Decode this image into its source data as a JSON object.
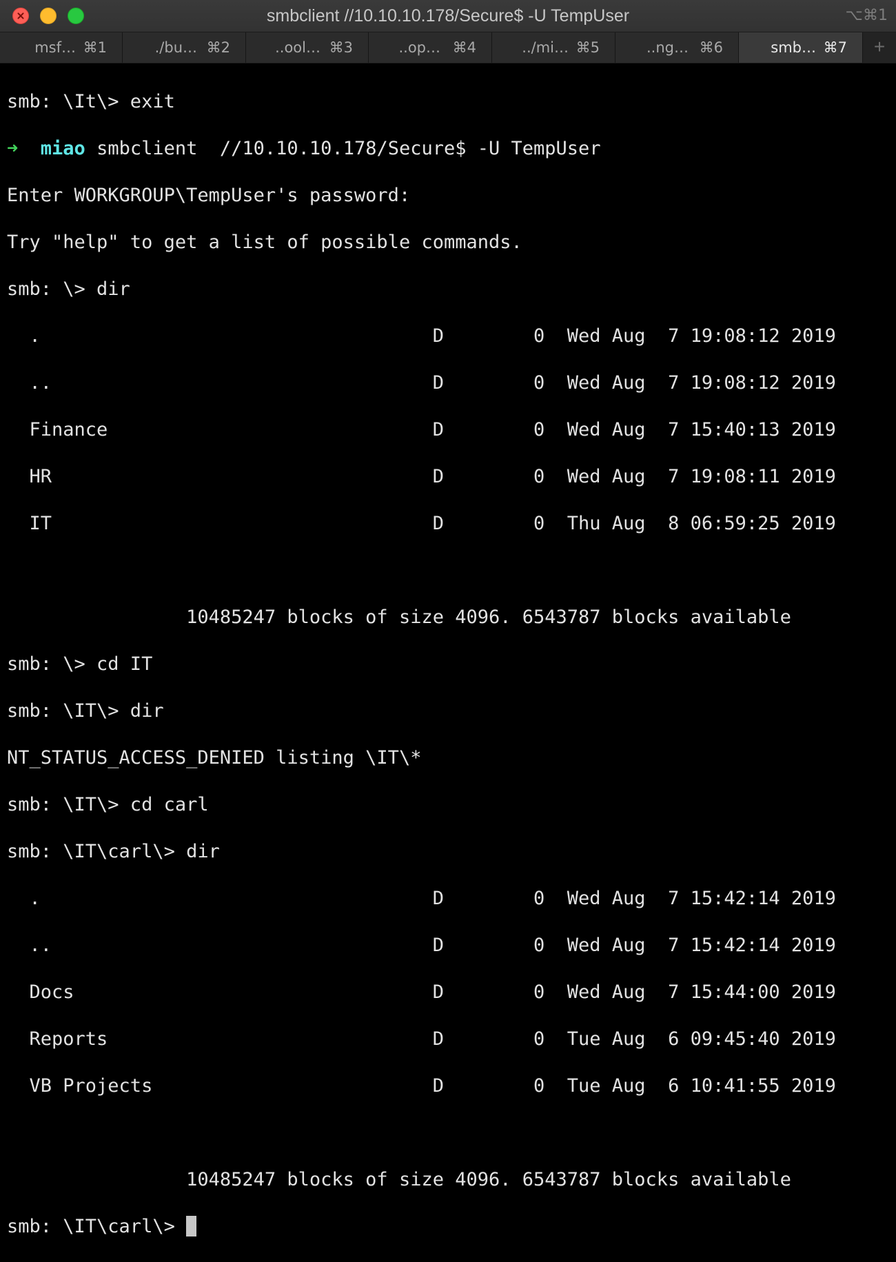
{
  "window": {
    "title": "smbclient //10.10.10.178/Secure$ -U TempUser",
    "shortcut": "⌥⌘1"
  },
  "tabs": [
    {
      "label": "msf…",
      "shortcut": "⌘1",
      "active": false
    },
    {
      "label": "./bu…",
      "shortcut": "⌘2",
      "active": false
    },
    {
      "label": "..ool…",
      "shortcut": "⌘3",
      "active": false
    },
    {
      "label": "..op…",
      "shortcut": "⌘4",
      "active": false
    },
    {
      "label": "../mi…",
      "shortcut": "⌘5",
      "active": false
    },
    {
      "label": "..ng…",
      "shortcut": "⌘6",
      "active": false
    },
    {
      "label": "smb…",
      "shortcut": "⌘7",
      "active": true
    }
  ],
  "add_tab_label": "+",
  "terminal": {
    "prompt_arrow": "➜",
    "prompt_user": "miao",
    "lines": [
      "smb: \\It\\> exit",
      "smbclient  //10.10.10.178/Secure$ -U TempUser",
      "Enter WORKGROUP\\TempUser's password:",
      "Try \"help\" to get a list of possible commands.",
      "smb: \\> dir",
      "  .                                   D        0  Wed Aug  7 19:08:12 2019",
      "  ..                                  D        0  Wed Aug  7 19:08:12 2019",
      "  Finance                             D        0  Wed Aug  7 15:40:13 2019",
      "  HR                                  D        0  Wed Aug  7 19:08:11 2019",
      "  IT                                  D        0  Thu Aug  8 06:59:25 2019",
      "",
      "                10485247 blocks of size 4096. 6543787 blocks available",
      "smb: \\> cd IT",
      "smb: \\IT\\> dir",
      "NT_STATUS_ACCESS_DENIED listing \\IT\\*",
      "smb: \\IT\\> cd carl",
      "smb: \\IT\\carl\\> dir",
      "  .                                   D        0  Wed Aug  7 15:42:14 2019",
      "  ..                                  D        0  Wed Aug  7 15:42:14 2019",
      "  Docs                                D        0  Wed Aug  7 15:44:00 2019",
      "  Reports                             D        0  Tue Aug  6 09:45:40 2019",
      "  VB Projects                         D        0  Tue Aug  6 10:41:55 2019",
      "",
      "                10485247 blocks of size 4096. 6543787 blocks available",
      "smb: \\IT\\carl\\> "
    ]
  },
  "colors": {
    "background": "#000000",
    "text": "#e2e2e2",
    "prompt_arrow": "#42d25b",
    "prompt_user": "#5fe6e6"
  }
}
